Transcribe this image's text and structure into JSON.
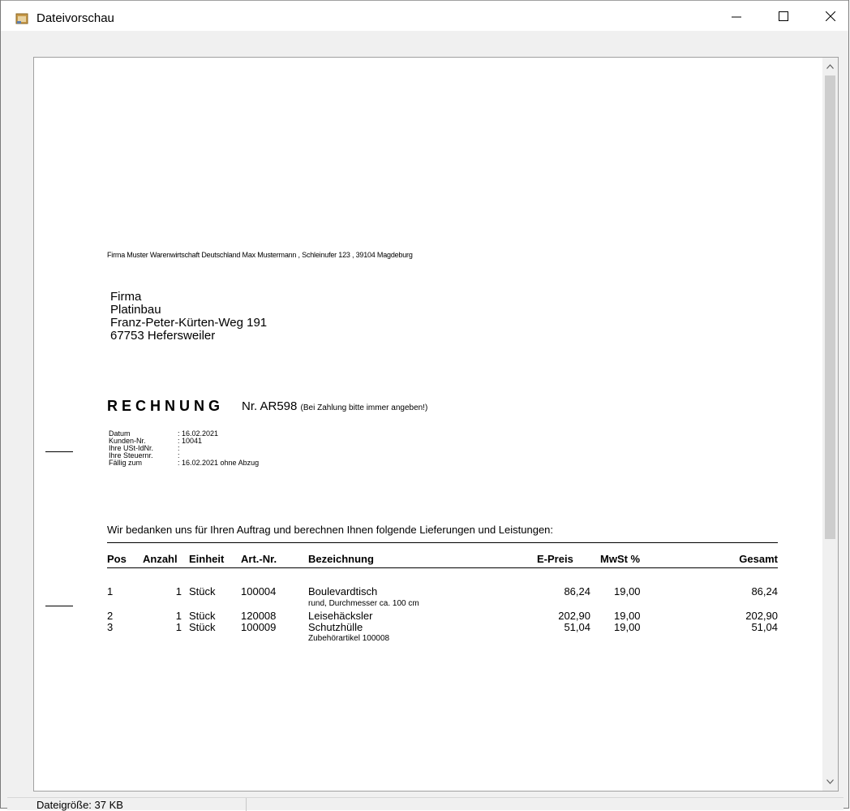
{
  "window": {
    "title": "Dateivorschau",
    "buttons": {
      "minimize": "—",
      "maximize": "☐",
      "close": "✕"
    }
  },
  "statusbar": {
    "text": "Dateigröße: 37 KB"
  },
  "document": {
    "sender_line": "Firma  Muster Warenwirtschaft Deutschland Max Mustermann , Schleinufer 123 , 39104 Magdeburg",
    "recipient": [
      "Firma",
      "Platinbau",
      "Franz-Peter-Kürten-Weg 191",
      "67753 Hefersweiler"
    ],
    "heading": "RECHNUNG",
    "number": "Nr. AR598",
    "number_note": "(Bei Zahlung bitte immer angeben!)",
    "meta": [
      {
        "label": "Datum",
        "value": ": 16.02.2021"
      },
      {
        "label": "Kunden-Nr.",
        "value": ": 10041"
      },
      {
        "label": "Ihre USt-IdNr.",
        "value": ":"
      },
      {
        "label": "Ihre Steuernr.",
        "value": ":"
      },
      {
        "label": "Fällig zum",
        "value": ": 16.02.2021 ohne Abzug"
      }
    ],
    "intro": "Wir bedanken uns für Ihren Auftrag und berechnen Ihnen folgende Lieferungen und Leistungen:",
    "table": {
      "headers": {
        "pos": "Pos",
        "anzahl": "Anzahl",
        "einheit": "Einheit",
        "artnr": "Art.-Nr.",
        "bezeichnung": "Bezeichnung",
        "epreis": "E-Preis",
        "mwst": "MwSt %",
        "gesamt": "Gesamt"
      },
      "rows": [
        {
          "pos": "1",
          "anzahl": "1",
          "einheit": "Stück",
          "artnr": "100004",
          "bezeichnung": "Boulevardtisch",
          "detail": "rund, Durchmesser ca. 100 cm",
          "epreis": "86,24",
          "mwst": "19,00",
          "gesamt": "86,24"
        },
        {
          "pos": "2",
          "anzahl": "1",
          "einheit": "Stück",
          "artnr": "120008",
          "bezeichnung": "Leisehäcksler",
          "detail": "",
          "epreis": "202,90",
          "mwst": "19,00",
          "gesamt": "202,90"
        },
        {
          "pos": "3",
          "anzahl": "1",
          "einheit": "Stück",
          "artnr": "100009",
          "bezeichnung": "Schutzhülle",
          "detail": "Zubehörartikel 100008",
          "epreis": "51,04",
          "mwst": "19,00",
          "gesamt": "51,04"
        }
      ]
    }
  }
}
